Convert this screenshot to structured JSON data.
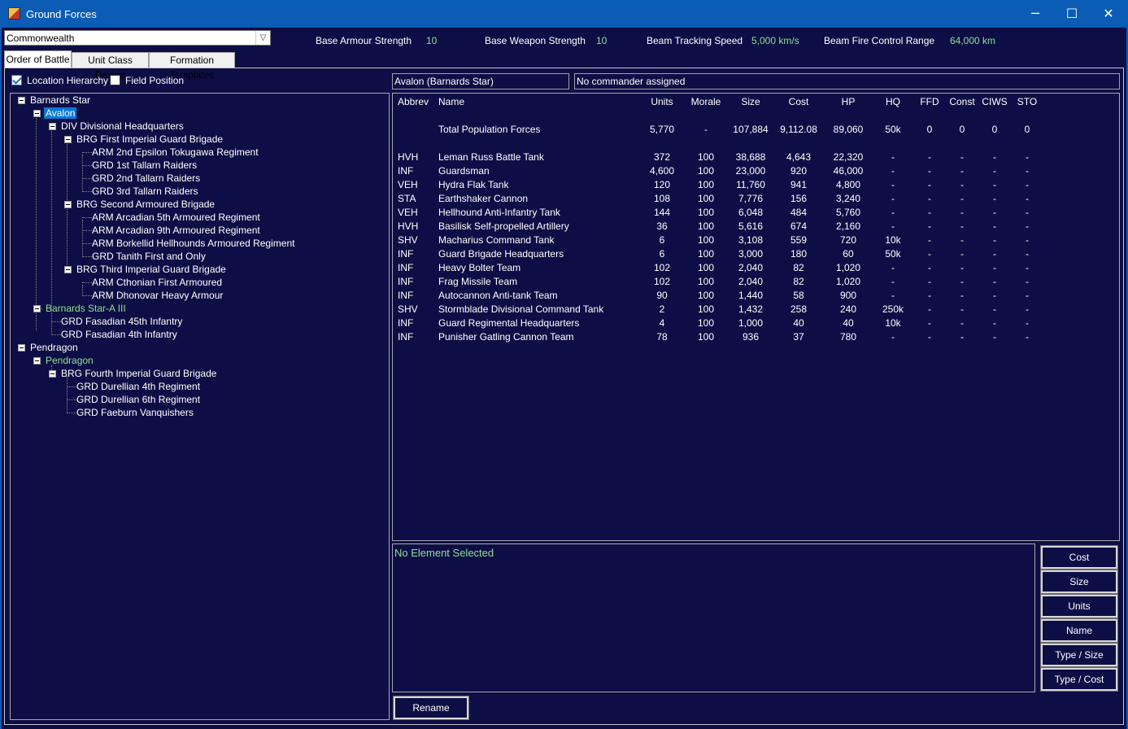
{
  "window": {
    "title": "Ground Forces",
    "minimize": "─",
    "maximize": "☐",
    "close": "✕"
  },
  "race_select": {
    "value": "Commonwealth"
  },
  "stats": {
    "armour_label": "Base Armour Strength",
    "armour_value": "10",
    "weapon_label": "Base Weapon Strength",
    "weapon_value": "10",
    "tracking_label": "Beam Tracking Speed",
    "tracking_value": "5,000 km/s",
    "fire_label": "Beam Fire Control Range",
    "fire_value": "64,000 km"
  },
  "tabs": [
    {
      "label": "Order of Battle"
    },
    {
      "label": "Unit Class Design"
    },
    {
      "label": "Formation Templates"
    }
  ],
  "options": {
    "location_hierarchy": "Location Hierarchy",
    "field_position": "Field Position"
  },
  "tree": [
    {
      "text": "Barnards Star"
    },
    {
      "text": "Avalon"
    },
    {
      "text": "DIV Divisional Headquarters"
    },
    {
      "text": "BRG First Imperial Guard Brigade"
    },
    {
      "text": "ARM 2nd Epsilon Tokugawa Regiment"
    },
    {
      "text": "GRD 1st Tallarn Raiders"
    },
    {
      "text": "GRD 2nd Tallarn Raiders"
    },
    {
      "text": "GRD 3rd Tallarn Raiders"
    },
    {
      "text": "BRG Second Armoured Brigade"
    },
    {
      "text": "ARM Arcadian 5th Armoured Regiment"
    },
    {
      "text": "ARM Arcadian 9th Armoured Regiment"
    },
    {
      "text": "ARM Borkellid Hellhounds Armoured Regiment"
    },
    {
      "text": "GRD Tanith First and Only"
    },
    {
      "text": "BRG Third Imperial Guard Brigade"
    },
    {
      "text": "ARM Cthonian First Armoured"
    },
    {
      "text": "ARM Dhonovar Heavy Armour"
    },
    {
      "text": "Barnards Star-A III"
    },
    {
      "text": "GRD Fasadian 45th Infantry"
    },
    {
      "text": "GRD Fasadian 4th Infantry"
    },
    {
      "text": "Pendragon"
    },
    {
      "text": "Pendragon"
    },
    {
      "text": "BRG Fourth Imperial Guard Brigade"
    },
    {
      "text": "GRD Durellian 4th Regiment"
    },
    {
      "text": "GRD Durellian 6th Regiment"
    },
    {
      "text": "GRD Faeburn Vanquishers"
    }
  ],
  "location_box": "Avalon  (Barnards Star)",
  "commander_box": "No commander assigned",
  "table": {
    "headers": [
      "Abbrev",
      "Name",
      "Units",
      "Morale",
      "Size",
      "Cost",
      "HP",
      "HQ",
      "FFD",
      "Const",
      "CIWS",
      "STO"
    ],
    "total": [
      "",
      "Total Population Forces",
      "5,770",
      "-",
      "107,884",
      "9,112.08",
      "89,060",
      "50k",
      "0",
      "0",
      "0",
      "0"
    ],
    "rows": [
      [
        "HVH",
        "Leman Russ Battle Tank",
        "372",
        "100",
        "38,688",
        "4,643",
        "22,320",
        "-",
        "-",
        "-",
        "-",
        "-"
      ],
      [
        "INF",
        "Guardsman",
        "4,600",
        "100",
        "23,000",
        "920",
        "46,000",
        "-",
        "-",
        "-",
        "-",
        "-"
      ],
      [
        "VEH",
        "Hydra Flak Tank",
        "120",
        "100",
        "11,760",
        "941",
        "4,800",
        "-",
        "-",
        "-",
        "-",
        "-"
      ],
      [
        "STA",
        "Earthshaker Cannon",
        "108",
        "100",
        "7,776",
        "156",
        "3,240",
        "-",
        "-",
        "-",
        "-",
        "-"
      ],
      [
        "VEH",
        "Hellhound Anti-Infantry Tank",
        "144",
        "100",
        "6,048",
        "484",
        "5,760",
        "-",
        "-",
        "-",
        "-",
        "-"
      ],
      [
        "HVH",
        "Basilisk Self-propelled Artillery",
        "36",
        "100",
        "5,616",
        "674",
        "2,160",
        "-",
        "-",
        "-",
        "-",
        "-"
      ],
      [
        "SHV",
        "Macharius Command Tank",
        "6",
        "100",
        "3,108",
        "559",
        "720",
        "10k",
        "-",
        "-",
        "-",
        "-"
      ],
      [
        "INF",
        "Guard Brigade Headquarters",
        "6",
        "100",
        "3,000",
        "180",
        "60",
        "50k",
        "-",
        "-",
        "-",
        "-"
      ],
      [
        "INF",
        "Heavy Bolter Team",
        "102",
        "100",
        "2,040",
        "82",
        "1,020",
        "-",
        "-",
        "-",
        "-",
        "-"
      ],
      [
        "INF",
        "Frag Missile Team",
        "102",
        "100",
        "2,040",
        "82",
        "1,020",
        "-",
        "-",
        "-",
        "-",
        "-"
      ],
      [
        "INF",
        "Autocannon Anti-tank Team",
        "90",
        "100",
        "1,440",
        "58",
        "900",
        "-",
        "-",
        "-",
        "-",
        "-"
      ],
      [
        "SHV",
        "Stormblade Divisional Command Tank",
        "2",
        "100",
        "1,432",
        "258",
        "240",
        "250k",
        "-",
        "-",
        "-",
        "-"
      ],
      [
        "INF",
        "Guard Regimental Headquarters",
        "4",
        "100",
        "1,000",
        "40",
        "40",
        "10k",
        "-",
        "-",
        "-",
        "-"
      ],
      [
        "INF",
        "Punisher Gatling Cannon Team",
        "78",
        "100",
        "936",
        "37",
        "780",
        "-",
        "-",
        "-",
        "-",
        "-"
      ]
    ]
  },
  "detail": {
    "text": "No Element Selected"
  },
  "sort_buttons": [
    "Cost",
    "Size",
    "Units",
    "Name",
    "Type / Size",
    "Type / Cost"
  ],
  "rename_button": "Rename"
}
